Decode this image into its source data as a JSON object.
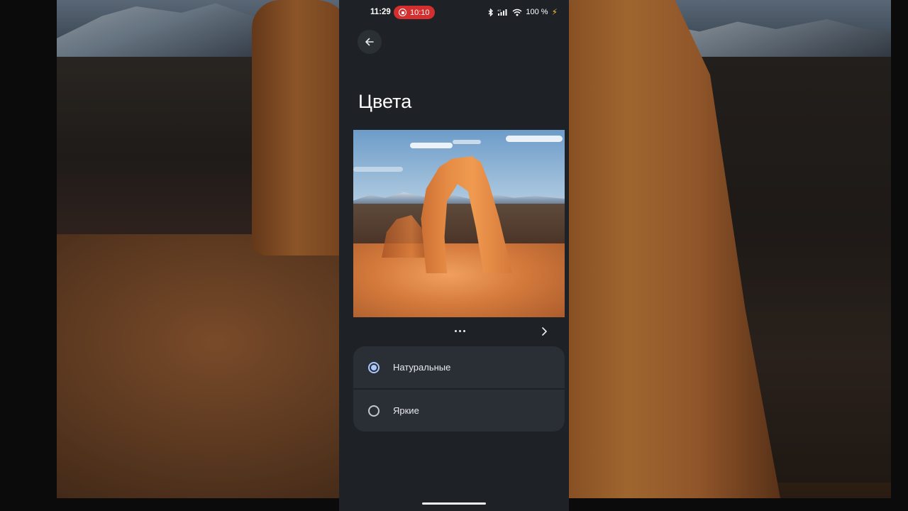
{
  "status_bar": {
    "time": "11:29",
    "recording_time": "10:10",
    "battery": "100 %",
    "icons": [
      "bluetooth-icon",
      "signal-icon",
      "wifi-icon",
      "charging-icon"
    ]
  },
  "header": {
    "back_icon": "arrow-left-icon",
    "title": "Цвета"
  },
  "preview": {
    "image": "delicate-arch-photo",
    "more_icon": "more-horizontal-icon",
    "next_icon": "chevron-right-icon"
  },
  "options": [
    {
      "label": "Натуральные",
      "selected": true
    },
    {
      "label": "Яркие",
      "selected": false
    }
  ],
  "colors": {
    "background": "#1e2125",
    "option_bg": "#2a2f36",
    "accent": "#a9c7ff",
    "record_pill": "#d32f2f"
  }
}
